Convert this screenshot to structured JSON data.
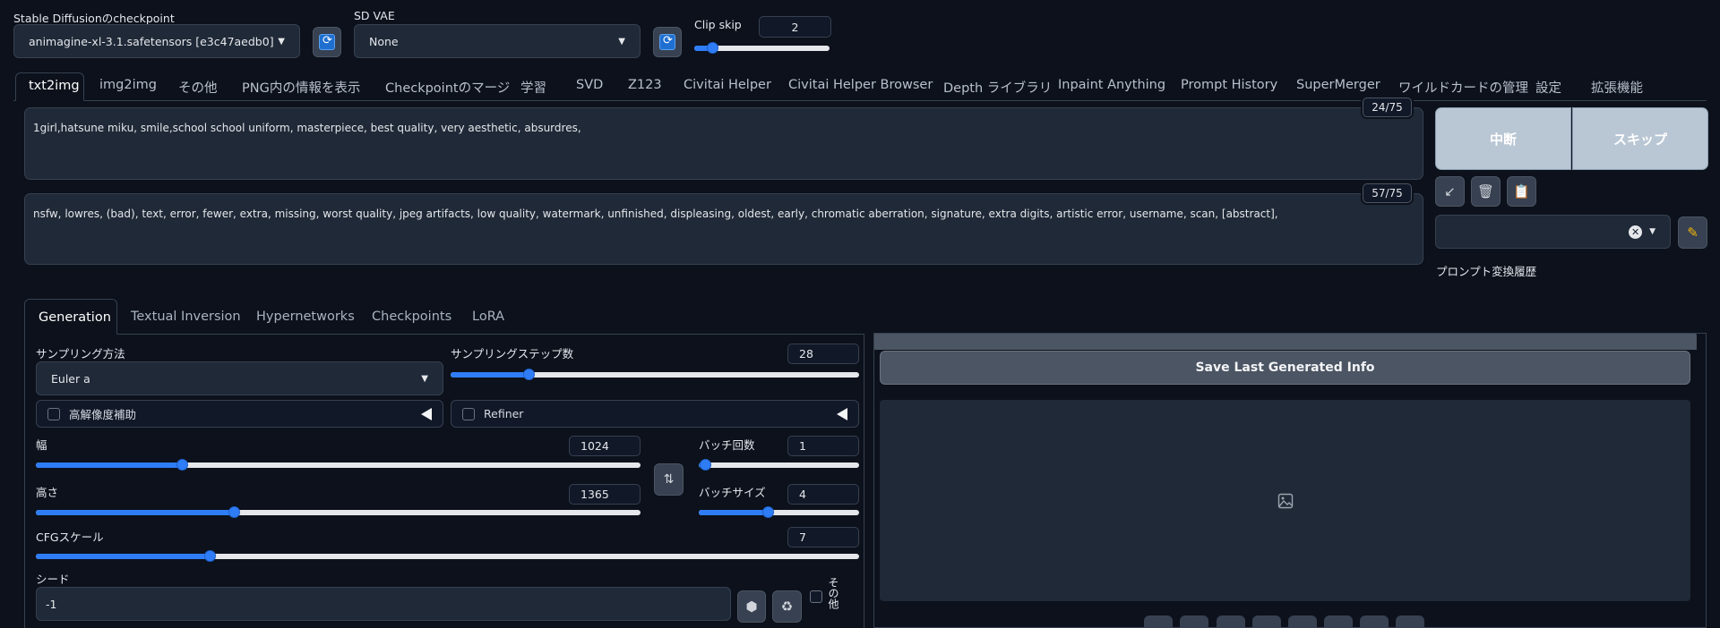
{
  "top": {
    "checkpoint_label": "Stable Diffusionのcheckpoint",
    "checkpoint_value": "animagine-xl-3.1.safetensors [e3c47aedb0]",
    "vae_label": "SD VAE",
    "vae_value": "None",
    "clip_skip_label": "Clip skip",
    "clip_skip_value": "2",
    "clip_skip_fraction": 0.1
  },
  "tabs": [
    "txt2img",
    "img2img",
    "その他",
    "PNG内の情報を表示",
    "Checkpointのマージ",
    "学習",
    "SVD",
    "Z123",
    "Civitai Helper",
    "Civitai Helper Browser",
    "Depth ライブラリ",
    "Inpaint Anything",
    "Prompt History",
    "SuperMerger",
    "ワイルドカードの管理",
    "設定",
    "拡張機能"
  ],
  "prompt": {
    "positive": "1girl,hatsune miku, smile,school school uniform,  masterpiece, best quality, very aesthetic, absurdres,",
    "positive_count": "24/75",
    "negative": "nsfw, lowres, (bad), text, error, fewer, extra, missing, worst quality, jpeg artifacts, low quality, watermark, unfinished, displeasing, oldest, early, chromatic aberration, signature, extra digits, artistic error, username, scan, [abstract],",
    "negative_count": "57/75"
  },
  "actions": {
    "interrupt_label": "中断",
    "skip_label": "スキップ",
    "history_label": "プロンプト変換履歴"
  },
  "gen_tabs": [
    "Generation",
    "Textual Inversion",
    "Hypernetworks",
    "Checkpoints",
    "LoRA"
  ],
  "generation": {
    "sampler_label": "サンプリング方法",
    "sampler_value": "Euler a",
    "steps_label": "サンプリングステップ数",
    "steps_value": "28",
    "hires_label": "高解像度補助",
    "refiner_label": "Refiner",
    "width_label": "幅",
    "width_value": "1024",
    "height_label": "高さ",
    "height_value": "1365",
    "batch_count_label": "バッチ回数",
    "batch_count_value": "1",
    "batch_size_label": "バッチサイズ",
    "batch_size_value": "4",
    "cfg_label": "CFGスケール",
    "cfg_value": "7",
    "seed_label": "シード",
    "seed_value": "-1",
    "extra_label": "その他"
  },
  "output": {
    "save_info_label": "Save Last Generated Info"
  },
  "colors": {
    "accent": "#2f7df6",
    "background": "#0c111b",
    "button_light": "#b9c6d4"
  }
}
